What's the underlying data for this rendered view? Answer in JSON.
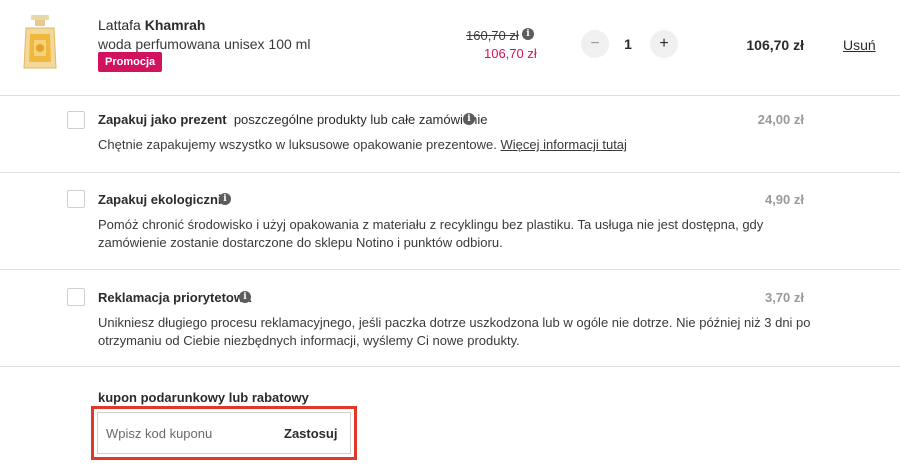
{
  "product": {
    "brand": "Lattafa",
    "name": "Khamrah",
    "description": "woda perfumowana unisex 100 ml",
    "badge": "Promocja",
    "old_price": "160,70 zł",
    "new_price": "106,70 zł",
    "quantity": "1",
    "minus_label": "−",
    "plus_label": "+",
    "total": "106,70 zł",
    "remove_label": "Usuń",
    "info_glyph": "i"
  },
  "options": [
    {
      "title": "Zapakuj jako prezent",
      "subtitle": "poszczególne produkty lub całe zamówienie",
      "price": "24,00 zł",
      "description": "Chętnie zapakujemy wszystko w luksusowe opakowanie prezentowe.",
      "link": "Więcej informacji tutaj"
    },
    {
      "title": "Zapakuj ekologicznie",
      "price": "4,90 zł",
      "description": "Pomóż chronić środowisko i użyj opakowania z materiału z recyklingu bez plastiku. Ta usługa nie jest dostępna, gdy zamówienie zostanie dostarczone do sklepu Notino i punktów odbioru."
    },
    {
      "title": "Reklamacja priorytetowa",
      "price": "3,70 zł",
      "description": "Unikniesz długiego procesu reklamacyjnego, jeśli paczka dotrze uszkodzona lub w ogóle nie dotrze. Nie później niż 3 dni po otrzymaniu od Ciebie niezbędnych informacji, wyślemy Ci nowe produkty."
    }
  ],
  "coupon": {
    "label": "kupon podarunkowy lub rabatowy",
    "placeholder": "Wpisz kod kuponu",
    "apply_label": "Zastosuj"
  },
  "colors": {
    "accent": "#d1125f",
    "highlight": "#e0392b",
    "muted_price": "#9a9a9a"
  }
}
